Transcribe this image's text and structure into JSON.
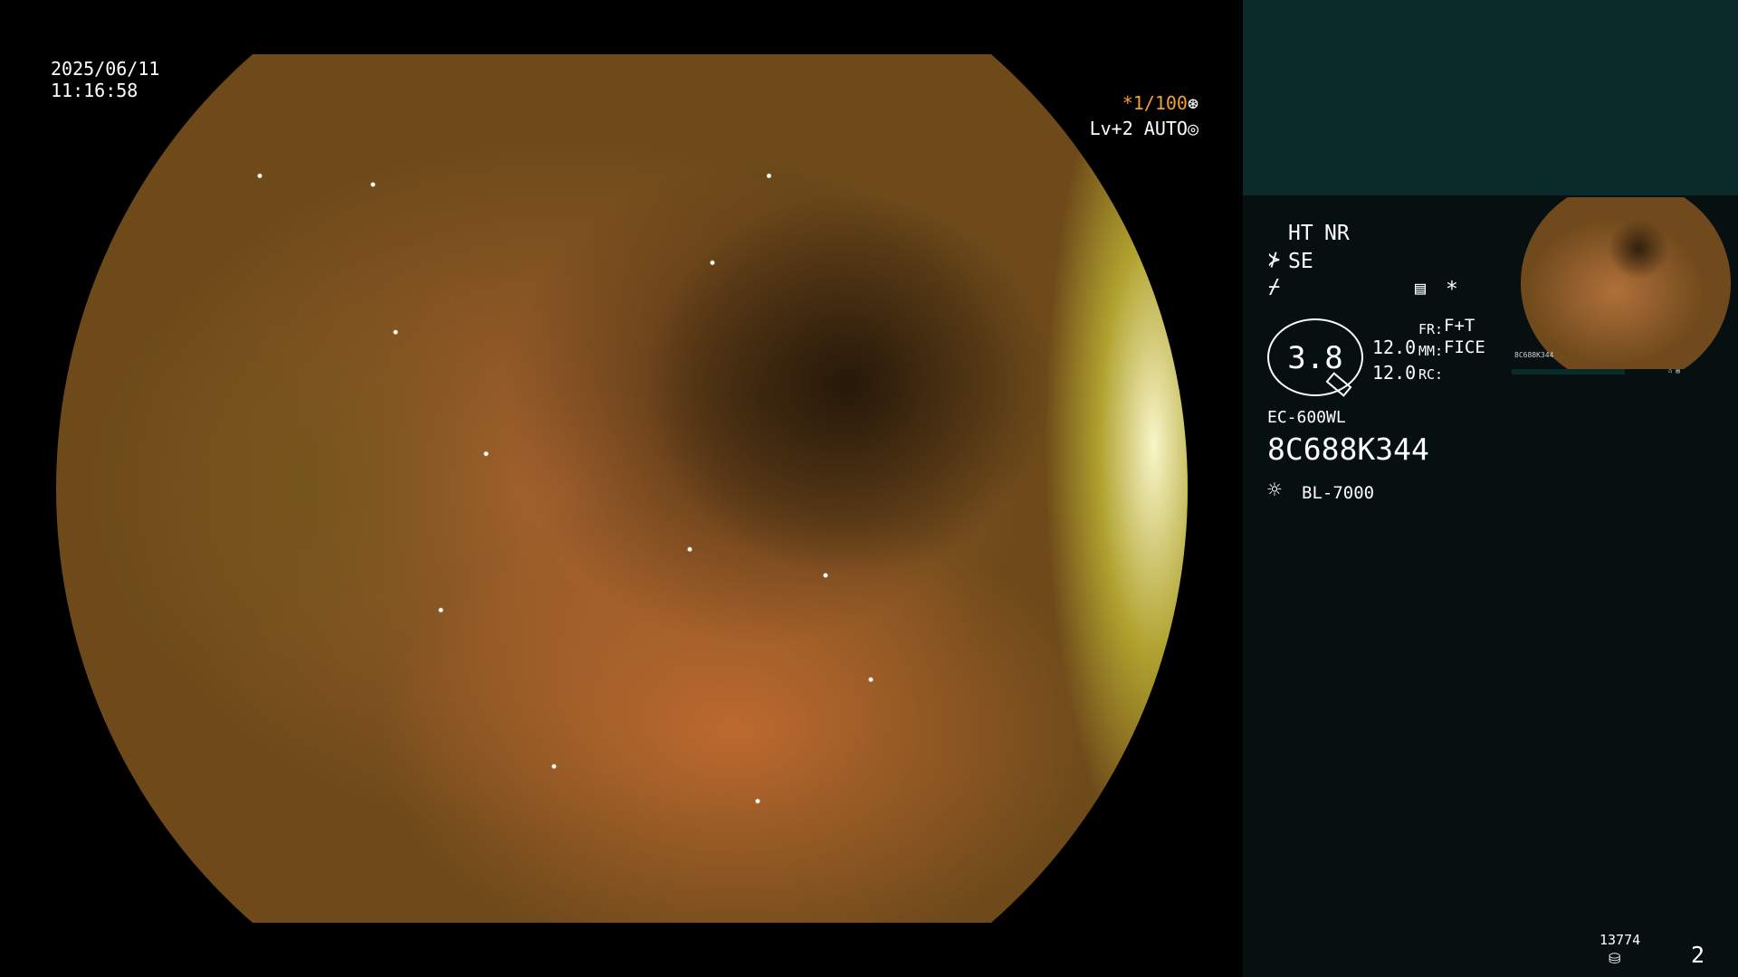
{
  "overlay": {
    "date": "2025/06/11",
    "time": "11:16:58",
    "shutter": "*1/100",
    "level": "Lv+2 AUTO"
  },
  "panel": {
    "ht": "HT",
    "nr": "NR",
    "se": "SE",
    "asterisk": "*",
    "zoom": "3.8",
    "val1": "12.0",
    "val2": "12.0",
    "fr_label": "FR:",
    "fr_value": "F+T",
    "mm_label": "MM:",
    "mm_value": "FICE",
    "rc_label": "RC:",
    "scope_model": "EC-600WL",
    "serial": "8C688K344",
    "light_source": "BL-7000",
    "count": "13774",
    "image_index": "2"
  },
  "thumbnail": {
    "info_left": "8C688K344"
  },
  "colors": {
    "accent_orange": "#f0a030",
    "panel_band": "#0b2b2a",
    "panel_bg": "#061010"
  }
}
